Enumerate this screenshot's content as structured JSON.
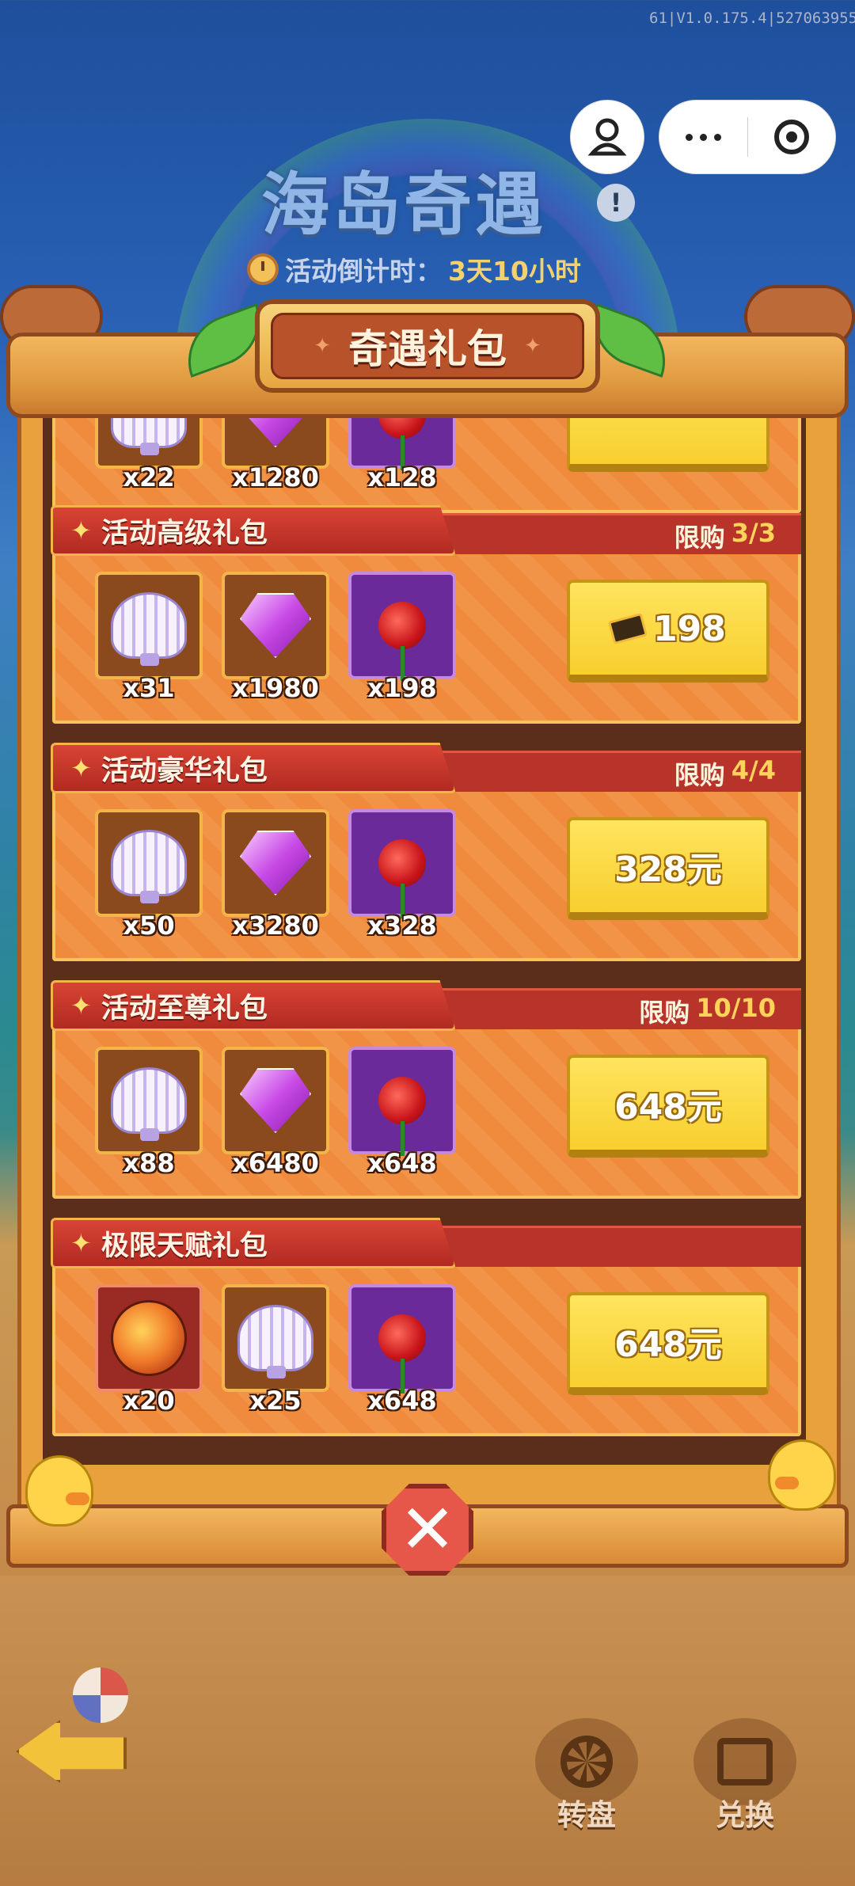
{
  "version": "61|V1.0.175.4|527063955",
  "event": {
    "title": "海岛奇遇",
    "countdown_label": "活动倒计时：",
    "countdown_value": "3天10小时"
  },
  "panel": {
    "title": "奇遇礼包"
  },
  "partial_card": {
    "items": [
      {
        "icon": "shell-icon",
        "qty": "x22"
      },
      {
        "icon": "gem-icon",
        "qty": "x1280"
      },
      {
        "icon": "rose-icon",
        "qty": "x128"
      }
    ]
  },
  "packages": [
    {
      "name": "活动高级礼包",
      "limit_label": "限购",
      "limit_value": "3/3",
      "items": [
        {
          "icon": "shell-icon",
          "qty": "x31"
        },
        {
          "icon": "gem-icon",
          "qty": "x1980"
        },
        {
          "icon": "rose-icon",
          "qty": "x198"
        }
      ],
      "price": "198",
      "price_icon": "ticket-icon"
    },
    {
      "name": "活动豪华礼包",
      "limit_label": "限购",
      "limit_value": "4/4",
      "items": [
        {
          "icon": "shell-icon",
          "qty": "x50"
        },
        {
          "icon": "gem-icon",
          "qty": "x3280"
        },
        {
          "icon": "rose-icon",
          "qty": "x328"
        }
      ],
      "price": "328元"
    },
    {
      "name": "活动至尊礼包",
      "limit_label": "限购",
      "limit_value": "10/10",
      "items": [
        {
          "icon": "shell-icon",
          "qty": "x88"
        },
        {
          "icon": "gem-icon",
          "qty": "x6480"
        },
        {
          "icon": "rose-icon",
          "qty": "x648"
        }
      ],
      "price": "648元"
    },
    {
      "name": "极限天赋礼包",
      "items": [
        {
          "icon": "devil-fruit-icon",
          "qty": "x20"
        },
        {
          "icon": "shell-icon",
          "qty": "x25"
        },
        {
          "icon": "rose-icon",
          "qty": "x648"
        }
      ],
      "price": "648元"
    }
  ],
  "bottom_nav": {
    "wheel_label": "转盘",
    "exchange_label": "兑换"
  },
  "colors": {
    "panel_orange": "#f08a3c",
    "button_yellow": "#f7cf2e",
    "tab_red": "#b8332a"
  }
}
